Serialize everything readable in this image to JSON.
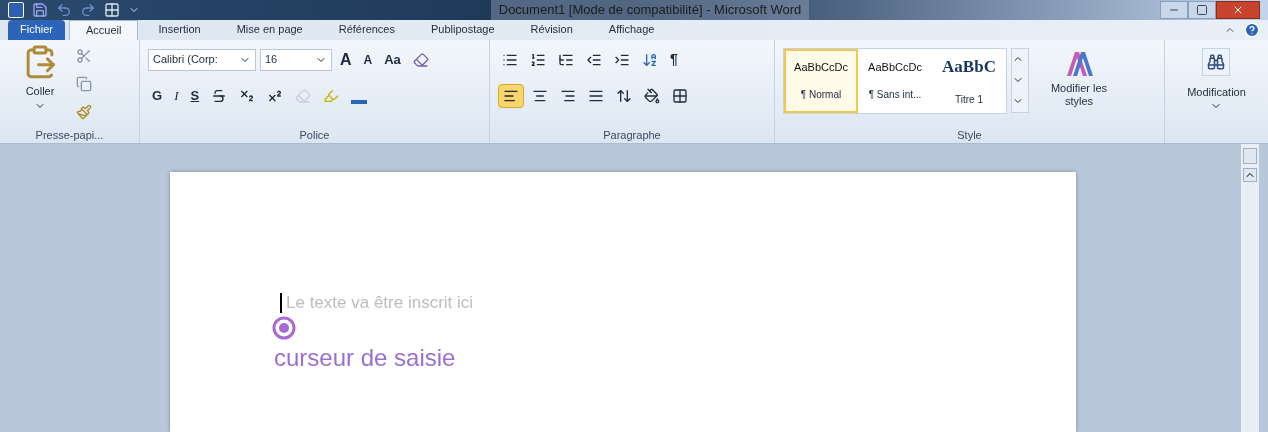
{
  "window": {
    "title": "Document1 [Mode de compatibilité] - Microsoft Word"
  },
  "tabs": [
    {
      "label": "Fichier",
      "kind": "file",
      "selected": false
    },
    {
      "label": "Accueil",
      "kind": "tab",
      "selected": true
    },
    {
      "label": "Insertion",
      "kind": "tab",
      "selected": false
    },
    {
      "label": "Mise en page",
      "kind": "tab",
      "selected": false
    },
    {
      "label": "Références",
      "kind": "tab",
      "selected": false
    },
    {
      "label": "Publipostage",
      "kind": "tab",
      "selected": false
    },
    {
      "label": "Révision",
      "kind": "tab",
      "selected": false
    },
    {
      "label": "Affichage",
      "kind": "tab",
      "selected": false
    }
  ],
  "ribbon": {
    "clipboard": {
      "paste_label": "Coller",
      "group_label": "Presse-papi..."
    },
    "font": {
      "font_name": "Calibri (Corp:",
      "font_size": "16",
      "grow": "A",
      "shrink": "A",
      "case": "Aa",
      "bold": "G",
      "italic": "I",
      "underline": "S",
      "group_label": "Police"
    },
    "paragraph": {
      "pilcrow": "¶",
      "alignments": [
        {
          "selected": true
        },
        {
          "selected": false
        },
        {
          "selected": false
        },
        {
          "selected": false
        }
      ],
      "group_label": "Paragraphe"
    },
    "styles": {
      "items": [
        {
          "preview": "AaBbCcDc",
          "name": "¶ Normal",
          "kind": "body",
          "selected": true
        },
        {
          "preview": "AaBbCcDc",
          "name": "¶ Sans int...",
          "kind": "body",
          "selected": false
        },
        {
          "preview": "AaBbC",
          "name": "Titre 1",
          "kind": "heading",
          "selected": false
        }
      ],
      "change_styles": "Modifier les styles",
      "group_label": "Style"
    },
    "editing": {
      "label": "Modification"
    }
  },
  "document": {
    "placeholder_text": "Le texte va être inscrit ici",
    "annotation": "curseur de saisie"
  }
}
